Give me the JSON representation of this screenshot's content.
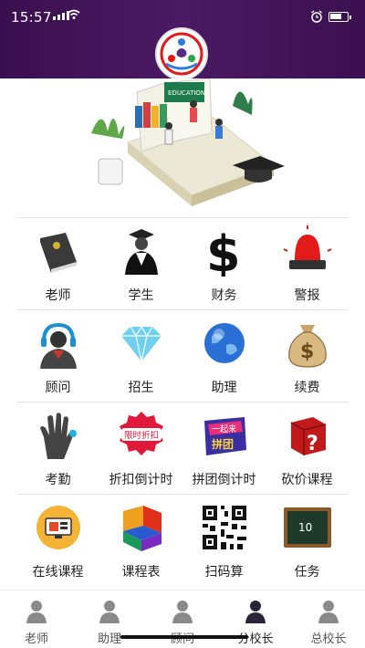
{
  "status_bar": {
    "time": "15:57"
  },
  "banner": {
    "sign_text": "EDUCATION"
  },
  "grid": {
    "items": [
      {
        "label": "老师",
        "icon": "book-icon"
      },
      {
        "label": "学生",
        "icon": "graduate-icon"
      },
      {
        "label": "财务",
        "icon": "dollar-icon"
      },
      {
        "label": "警报",
        "icon": "alarm-light-icon"
      },
      {
        "label": "顾问",
        "icon": "headset-consultant-icon"
      },
      {
        "label": "招生",
        "icon": "diamond-icon"
      },
      {
        "label": "助理",
        "icon": "globe-icon"
      },
      {
        "label": "续费",
        "icon": "money-bag-icon"
      },
      {
        "label": "考勤",
        "icon": "hand-icon"
      },
      {
        "label": "折扣倒计时",
        "icon": "discount-badge-icon",
        "badge_text": "限时折扣"
      },
      {
        "label": "拼团倒计时",
        "icon": "group-buy-badge-icon",
        "badge_text_top": "一起来",
        "badge_text_bottom": "拼团"
      },
      {
        "label": "砍价课程",
        "icon": "question-cube-icon"
      },
      {
        "label": "在线课程",
        "icon": "online-course-icon"
      },
      {
        "label": "课程表",
        "icon": "timetable-icon"
      },
      {
        "label": "扫码算",
        "icon": "qr-code-icon"
      },
      {
        "label": "任务",
        "icon": "task-board-icon",
        "board_number": "10"
      }
    ]
  },
  "tabs": [
    {
      "label": "老师"
    },
    {
      "label": "助理"
    },
    {
      "label": "顾问"
    },
    {
      "label": "分校长"
    },
    {
      "label": "总校长"
    }
  ],
  "colors": {
    "header": "#3f1256",
    "accent": "#e21a1a"
  }
}
